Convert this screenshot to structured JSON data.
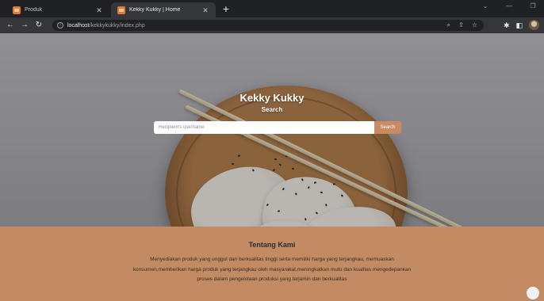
{
  "browser": {
    "tabs": [
      {
        "title": "Produk",
        "active": false
      },
      {
        "title": "Kekky Kukky | Home",
        "active": true
      }
    ],
    "url_host": "localhost",
    "url_path": "/kekkykukky/index.php"
  },
  "hero": {
    "title": "Kekky Kukky",
    "subtitle": "Search",
    "search_placeholder": "Recipient's username",
    "search_button": "Search"
  },
  "about": {
    "title": "Tentang Kami",
    "lines": [
      "Menyediakan produk yang unggul dan berkualitas tinggi serta memiliki harga yang terjangkau, memuaskan",
      "konsumen,memberikan harga produk yang terjangkau oleh masyarakat,meningkatkan mutu dan kualitas mengedepankan",
      "proses dalam pengelolaan produksi yang terjamin dan berkualitas"
    ]
  },
  "colors": {
    "accent": "#c98b62",
    "about_bg": "#c28b63",
    "browser_dark": "#202124"
  }
}
